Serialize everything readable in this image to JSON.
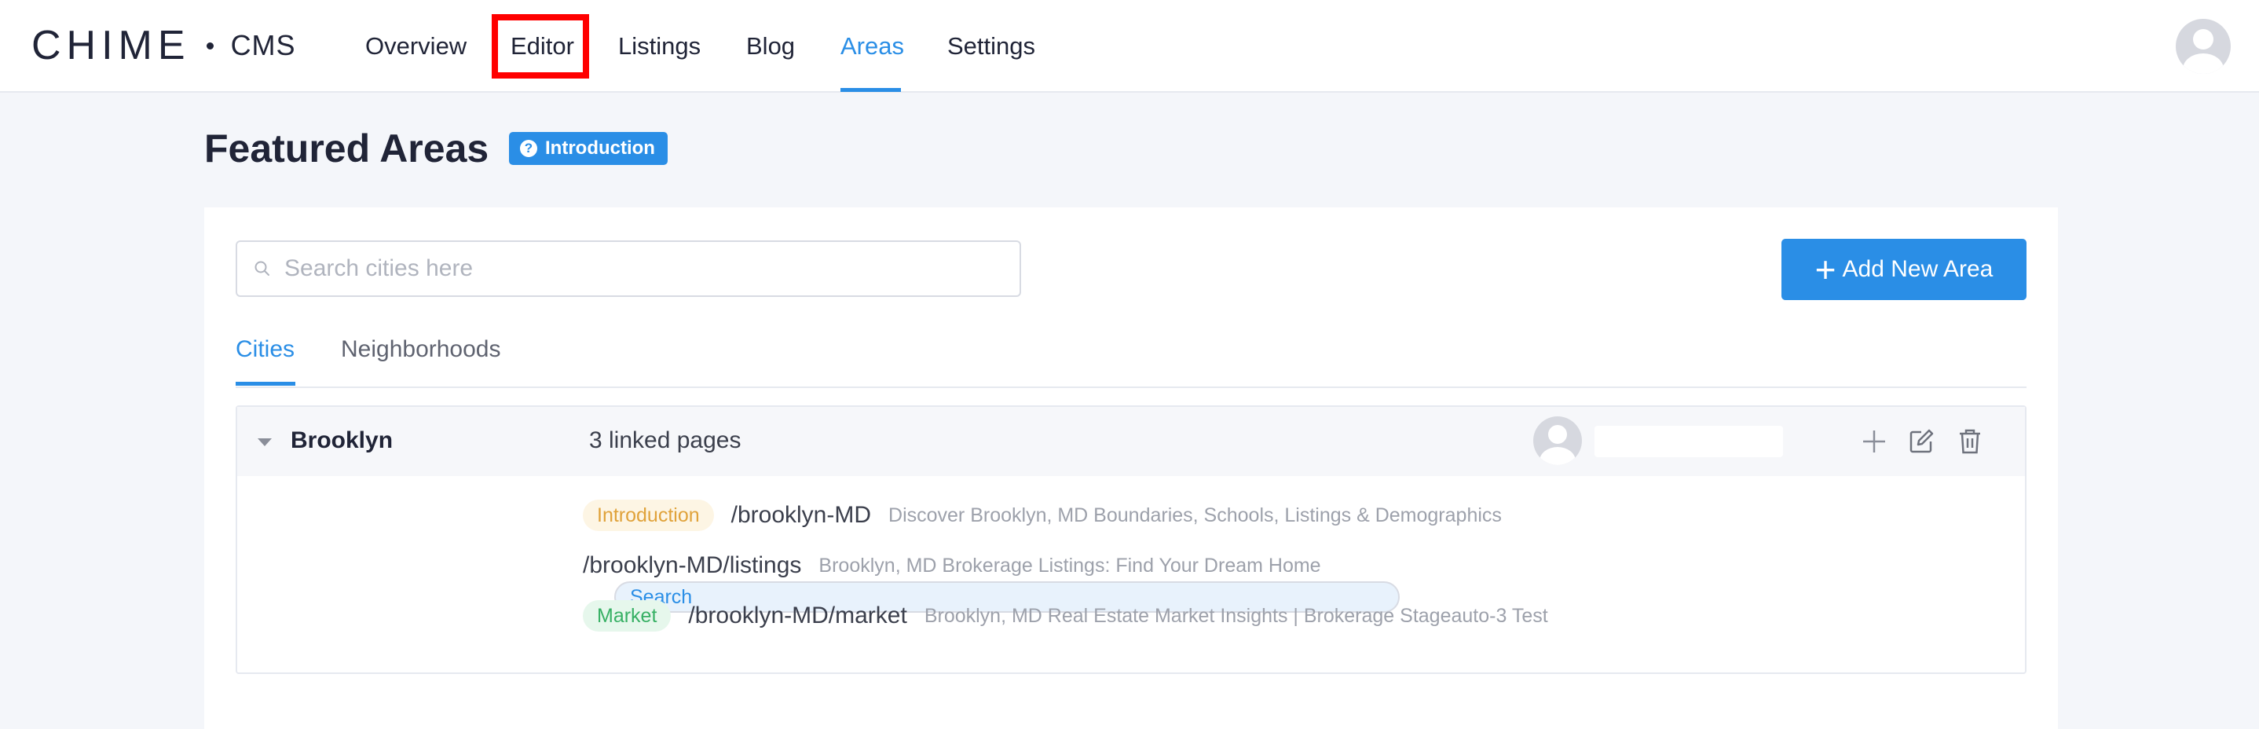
{
  "brand": {
    "logo": "CHIME",
    "product": "CMS"
  },
  "nav": {
    "items": [
      {
        "id": "overview",
        "label": "Overview"
      },
      {
        "id": "editor",
        "label": "Editor"
      },
      {
        "id": "listings",
        "label": "Listings"
      },
      {
        "id": "blog",
        "label": "Blog"
      },
      {
        "id": "areas",
        "label": "Areas"
      },
      {
        "id": "settings",
        "label": "Settings"
      }
    ],
    "active": "Areas",
    "highlighted": "Editor"
  },
  "page": {
    "title": "Featured Areas",
    "intro_badge": "Introduction"
  },
  "search": {
    "placeholder": "Search cities here",
    "value": ""
  },
  "add_button": {
    "label": "Add New Area"
  },
  "tabs": [
    {
      "label": "Cities",
      "active": true
    },
    {
      "label": "Neighborhoods",
      "active": false
    }
  ],
  "areas": [
    {
      "name": "Brooklyn",
      "linked_pages": "3 linked pages",
      "pages": [
        {
          "tag": "Introduction",
          "slug": "/brooklyn-MD",
          "description": "Discover Brooklyn, MD Boundaries, Schools, Listings & Demographics"
        },
        {
          "tag": "Search",
          "slug": "/brooklyn-MD/listings",
          "description": "Brooklyn, MD Brokerage Listings: Find Your Dream Home"
        },
        {
          "tag": "Market",
          "slug": "/brooklyn-MD/market",
          "description": "Brooklyn, MD Real Estate Market Insights | Brokerage Stageauto-3 Test"
        }
      ]
    }
  ],
  "colors": {
    "accent": "#2a8ee6",
    "highlight": "#ff0000",
    "tag_intro": "#e0a23a",
    "tag_search": "#2a8ee6",
    "tag_market": "#37b064"
  },
  "icons": {
    "search": "search-icon",
    "plus": "plus-icon",
    "caret": "caret-down-icon",
    "add_page": "plus-icon",
    "edit": "edit-icon",
    "delete": "trash-icon",
    "avatar": "user-avatar-icon"
  }
}
